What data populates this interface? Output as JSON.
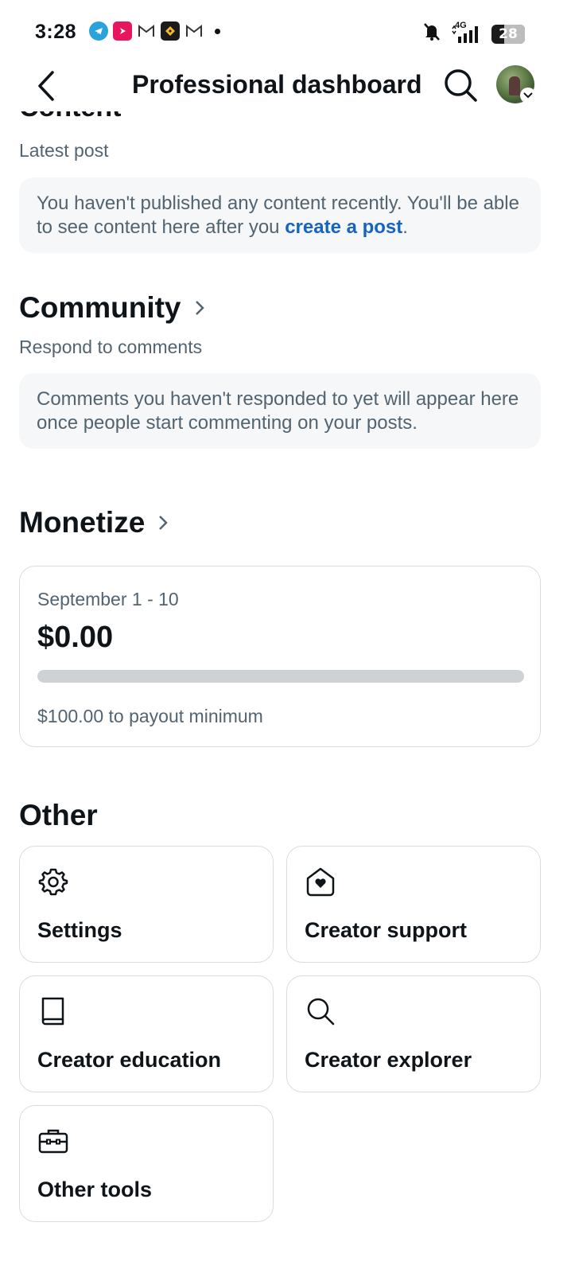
{
  "status_bar": {
    "time": "3:28",
    "network": "4G",
    "battery": "28"
  },
  "header": {
    "title": "Professional dashboard"
  },
  "content_section": {
    "heading_partial": "Content",
    "subtitle": "Latest post",
    "empty_text": "You haven't published any content recently. You'll be able to see content here after you ",
    "link_text": "create a post",
    "empty_suffix": "."
  },
  "community_section": {
    "heading": "Community",
    "subtitle": "Respond to comments",
    "empty_text": "Comments you haven't responded to yet will appear here once people start commenting on your posts."
  },
  "monetize_section": {
    "heading": "Monetize",
    "period": "September 1 - 10",
    "amount": "$0.00",
    "progress_fraction": 0,
    "payout_text": "$100.00 to payout minimum"
  },
  "other_section": {
    "heading": "Other",
    "tiles": [
      {
        "label": "Settings",
        "icon": "gear-icon"
      },
      {
        "label": "Creator support",
        "icon": "house-heart-icon"
      },
      {
        "label": "Creator education",
        "icon": "book-icon"
      },
      {
        "label": "Creator explorer",
        "icon": "search-icon"
      },
      {
        "label": "Other tools",
        "icon": "toolbox-icon"
      }
    ]
  },
  "colors": {
    "link": "#1565c0",
    "secondary_text": "#536471",
    "card_bg": "#f5f7f9",
    "border": "#d8dde2",
    "progress_track": "#cfd2d5"
  }
}
